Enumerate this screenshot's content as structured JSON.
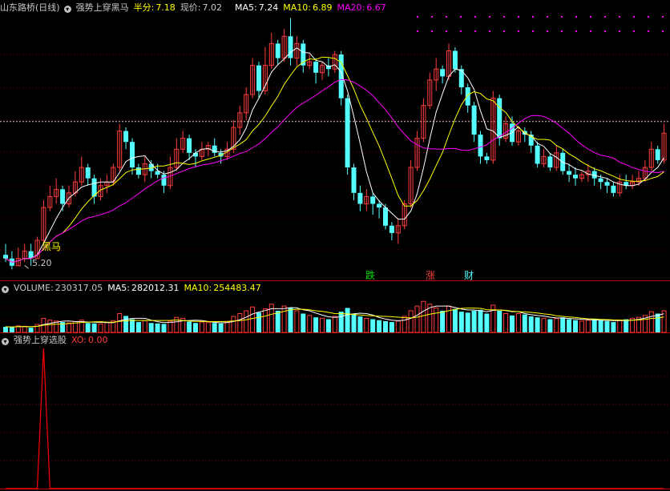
{
  "colors": {
    "up": "#ff3c3c",
    "down": "#54ffff",
    "ma5": "#ffffff",
    "ma10": "#ffff00",
    "ma20": "#ff00ff",
    "grid": "#7a0000",
    "frame": "#c00000",
    "xo": "#ff0000",
    "text": "#c8c8c8"
  },
  "main_header": {
    "title": "山东路桥(日线)",
    "indicator": "强势上穿黑马",
    "half_label": "半分:",
    "half_value": "7.18",
    "price_label": "现价:",
    "price_value": "7.02",
    "ma5_label": "MA5:",
    "ma5_value": "7.24",
    "ma10_label": "MA10:",
    "ma10_value": "6.89",
    "ma20_label": "MA20:",
    "ma20_value": "6.67"
  },
  "volume_header": {
    "label": "VOLUME:",
    "value": "230317.05",
    "ma5_label": "MA5:",
    "ma5_value": "282012.31",
    "ma10_label": "MA10:",
    "ma10_value": "254483.47"
  },
  "xo_header": {
    "indicator": "强势上穿选股",
    "label": "XO:",
    "value": "0.00"
  },
  "annotations": {
    "heima": "黑马",
    "low_price": "5.20",
    "die": "跌",
    "zhang": "涨",
    "cai": "财"
  },
  "chart_data": {
    "type": "candlestick",
    "title": "山东路桥(日线)",
    "price_range": [
      5.0,
      8.65
    ],
    "volume_range": [
      0,
      400000
    ],
    "xo_range": [
      0,
      1
    ],
    "candles": [
      [
        5.35,
        5.3,
        5.5,
        5.25
      ],
      [
        5.3,
        5.2,
        5.4,
        5.15
      ],
      [
        5.2,
        5.3,
        5.45,
        5.2
      ],
      [
        5.3,
        5.4,
        5.5,
        5.25
      ],
      [
        5.4,
        5.3,
        5.5,
        5.2
      ],
      [
        5.3,
        5.55,
        5.6,
        5.3
      ],
      [
        5.55,
        6.0,
        6.1,
        5.5
      ],
      [
        6.0,
        6.15,
        6.3,
        5.95
      ],
      [
        6.15,
        6.25,
        6.4,
        6.05
      ],
      [
        6.25,
        6.05,
        6.3,
        5.95
      ],
      [
        6.05,
        6.2,
        6.3,
        6.0
      ],
      [
        6.2,
        6.35,
        6.5,
        6.15
      ],
      [
        6.35,
        6.55,
        6.7,
        6.3
      ],
      [
        6.55,
        6.4,
        6.6,
        6.3
      ],
      [
        6.4,
        6.15,
        6.45,
        6.05
      ],
      [
        6.15,
        6.3,
        6.4,
        6.1
      ],
      [
        6.3,
        6.35,
        6.45,
        6.2
      ],
      [
        6.35,
        6.55,
        6.6,
        6.3
      ],
      [
        6.55,
        7.05,
        7.15,
        6.5
      ],
      [
        7.05,
        6.9,
        7.1,
        6.8
      ],
      [
        6.9,
        6.55,
        6.95,
        6.45
      ],
      [
        6.55,
        6.45,
        6.6,
        6.4
      ],
      [
        6.45,
        6.6,
        6.7,
        6.35
      ],
      [
        6.6,
        6.5,
        6.65,
        6.4
      ],
      [
        6.5,
        6.45,
        6.6,
        6.4
      ],
      [
        6.45,
        6.3,
        6.5,
        6.2
      ],
      [
        6.3,
        6.55,
        6.7,
        6.25
      ],
      [
        6.55,
        6.8,
        6.95,
        6.5
      ],
      [
        6.8,
        6.95,
        7.05,
        6.75
      ],
      [
        6.95,
        6.75,
        7.0,
        6.65
      ],
      [
        6.75,
        6.7,
        6.8,
        6.55
      ],
      [
        6.7,
        6.8,
        6.9,
        6.65
      ],
      [
        6.8,
        6.85,
        6.9,
        6.7
      ],
      [
        6.85,
        6.75,
        6.95,
        6.7
      ],
      [
        6.75,
        6.7,
        6.8,
        6.6
      ],
      [
        6.7,
        6.8,
        6.9,
        6.65
      ],
      [
        6.8,
        7.1,
        7.2,
        6.75
      ],
      [
        7.1,
        7.3,
        7.4,
        7.0
      ],
      [
        7.3,
        7.55,
        7.65,
        7.2
      ],
      [
        7.55,
        7.95,
        8.05,
        7.5
      ],
      [
        7.95,
        7.6,
        8.0,
        7.5
      ],
      [
        7.6,
        7.95,
        8.2,
        7.55
      ],
      [
        7.95,
        8.25,
        8.4,
        7.9
      ],
      [
        8.25,
        8.05,
        8.3,
        7.95
      ],
      [
        8.05,
        8.35,
        8.45,
        8.0
      ],
      [
        8.35,
        8.05,
        8.6,
        7.95
      ],
      [
        8.05,
        8.25,
        8.35,
        7.95
      ],
      [
        8.25,
        7.95,
        8.3,
        7.85
      ],
      [
        7.95,
        8.0,
        8.1,
        7.9
      ],
      [
        8.0,
        7.85,
        8.05,
        7.7
      ],
      [
        7.85,
        7.95,
        8.0,
        7.75
      ],
      [
        7.95,
        7.9,
        8.05,
        7.8
      ],
      [
        7.9,
        8.1,
        8.15,
        7.85
      ],
      [
        8.1,
        7.5,
        8.15,
        7.4
      ],
      [
        7.5,
        6.55,
        7.55,
        6.45
      ],
      [
        6.55,
        6.2,
        6.6,
        6.1
      ],
      [
        6.2,
        6.05,
        6.3,
        5.95
      ],
      [
        6.05,
        6.15,
        6.25,
        5.95
      ],
      [
        6.15,
        6.05,
        6.2,
        5.9
      ],
      [
        6.05,
        6.0,
        6.1,
        5.85
      ],
      [
        6.0,
        5.75,
        6.05,
        5.7
      ],
      [
        5.75,
        5.65,
        5.8,
        5.55
      ],
      [
        5.65,
        5.75,
        5.85,
        5.5
      ],
      [
        5.75,
        6.05,
        6.1,
        5.7
      ],
      [
        6.05,
        6.55,
        6.65,
        6.0
      ],
      [
        6.55,
        6.95,
        7.05,
        6.5
      ],
      [
        6.95,
        7.4,
        7.5,
        6.9
      ],
      [
        7.4,
        7.75,
        7.85,
        7.35
      ],
      [
        7.75,
        7.9,
        8.05,
        7.6
      ],
      [
        7.9,
        7.8,
        7.95,
        7.7
      ],
      [
        7.8,
        8.15,
        8.25,
        7.75
      ],
      [
        8.15,
        7.9,
        8.2,
        7.85
      ],
      [
        7.9,
        7.65,
        7.95,
        7.55
      ],
      [
        7.65,
        7.4,
        7.7,
        7.3
      ],
      [
        7.4,
        7.0,
        7.45,
        6.9
      ],
      [
        7.0,
        6.7,
        7.05,
        6.6
      ],
      [
        6.7,
        6.65,
        6.75,
        6.6
      ],
      [
        6.65,
        7.5,
        7.6,
        6.6
      ],
      [
        7.5,
        6.95,
        7.55,
        6.85
      ],
      [
        6.95,
        7.15,
        7.25,
        6.9
      ],
      [
        7.15,
        6.9,
        7.25,
        6.85
      ],
      [
        6.9,
        7.05,
        7.1,
        6.85
      ],
      [
        7.05,
        7.0,
        7.1,
        6.9
      ],
      [
        7.0,
        6.85,
        7.05,
        6.75
      ],
      [
        6.85,
        6.6,
        6.9,
        6.55
      ],
      [
        6.6,
        6.7,
        6.8,
        6.55
      ],
      [
        6.7,
        6.55,
        6.75,
        6.5
      ],
      [
        6.55,
        6.75,
        6.85,
        6.5
      ],
      [
        6.75,
        6.5,
        6.8,
        6.45
      ],
      [
        6.5,
        6.45,
        6.6,
        6.35
      ],
      [
        6.45,
        6.4,
        6.55,
        6.3
      ],
      [
        6.4,
        6.45,
        6.5,
        6.35
      ],
      [
        6.45,
        6.5,
        6.6,
        6.35
      ],
      [
        6.5,
        6.4,
        6.55,
        6.3
      ],
      [
        6.4,
        6.35,
        6.45,
        6.25
      ],
      [
        6.35,
        6.3,
        6.4,
        6.2
      ],
      [
        6.3,
        6.2,
        6.35,
        6.15
      ],
      [
        6.2,
        6.35,
        6.45,
        6.15
      ],
      [
        6.35,
        6.3,
        6.45,
        6.25
      ],
      [
        6.3,
        6.35,
        6.45,
        6.25
      ],
      [
        6.35,
        6.4,
        6.5,
        6.3
      ],
      [
        6.4,
        6.55,
        6.65,
        6.35
      ],
      [
        6.55,
        6.8,
        6.9,
        6.5
      ],
      [
        6.8,
        6.65,
        6.85,
        6.6
      ],
      [
        6.65,
        7.02,
        7.15,
        6.6
      ]
    ],
    "volume": [
      60000,
      55000,
      70000,
      65000,
      50000,
      85000,
      150000,
      130000,
      120000,
      110000,
      100000,
      115000,
      130000,
      100000,
      95000,
      90000,
      105000,
      125000,
      200000,
      175000,
      140000,
      110000,
      125000,
      100000,
      95000,
      90000,
      120000,
      160000,
      150000,
      115000,
      100000,
      110000,
      105000,
      100000,
      95000,
      110000,
      170000,
      200000,
      230000,
      270000,
      210000,
      250000,
      300000,
      230000,
      280000,
      260000,
      230000,
      200000,
      180000,
      160000,
      150000,
      140000,
      170000,
      220000,
      260000,
      200000,
      170000,
      150000,
      140000,
      130000,
      120000,
      110000,
      120000,
      170000,
      230000,
      280000,
      330000,
      300000,
      260000,
      230000,
      280000,
      250000,
      220000,
      210000,
      230000,
      240000,
      200000,
      290000,
      230000,
      200000,
      180000,
      200000,
      190000,
      170000,
      160000,
      150000,
      140000,
      150000,
      160000,
      140000,
      130000,
      120000,
      130000,
      140000,
      130000,
      120000,
      110000,
      130000,
      140000,
      150000,
      160000,
      180000,
      220000,
      200000,
      230000
    ],
    "xo": [
      0,
      0,
      0,
      0,
      0,
      0,
      1,
      0,
      0,
      0,
      0,
      0,
      0,
      0,
      0,
      0,
      0,
      0,
      0,
      0,
      0,
      0,
      0,
      0,
      0,
      0,
      0,
      0,
      0,
      0,
      0,
      0,
      0,
      0,
      0,
      0,
      0,
      0,
      0,
      0,
      0,
      0,
      0,
      0,
      0,
      0,
      0,
      0,
      0,
      0,
      0,
      0,
      0,
      0,
      0,
      0,
      0,
      0,
      0,
      0,
      0,
      0,
      0,
      0,
      0,
      0,
      0,
      0,
      0,
      0,
      0,
      0,
      0,
      0,
      0,
      0,
      0,
      0,
      0,
      0,
      0,
      0,
      0,
      0,
      0,
      0,
      0,
      0,
      0,
      0,
      0,
      0,
      0,
      0,
      0,
      0,
      0,
      0,
      0,
      0,
      0,
      0,
      0,
      0,
      0
    ],
    "markers": [
      {
        "index": 6,
        "text": "黑马"
      },
      {
        "index": 3,
        "text": "5.20"
      },
      {
        "index": 56,
        "text": "跌"
      },
      {
        "index": 66,
        "text": "涨"
      },
      {
        "index": 72,
        "text": "财"
      }
    ]
  }
}
